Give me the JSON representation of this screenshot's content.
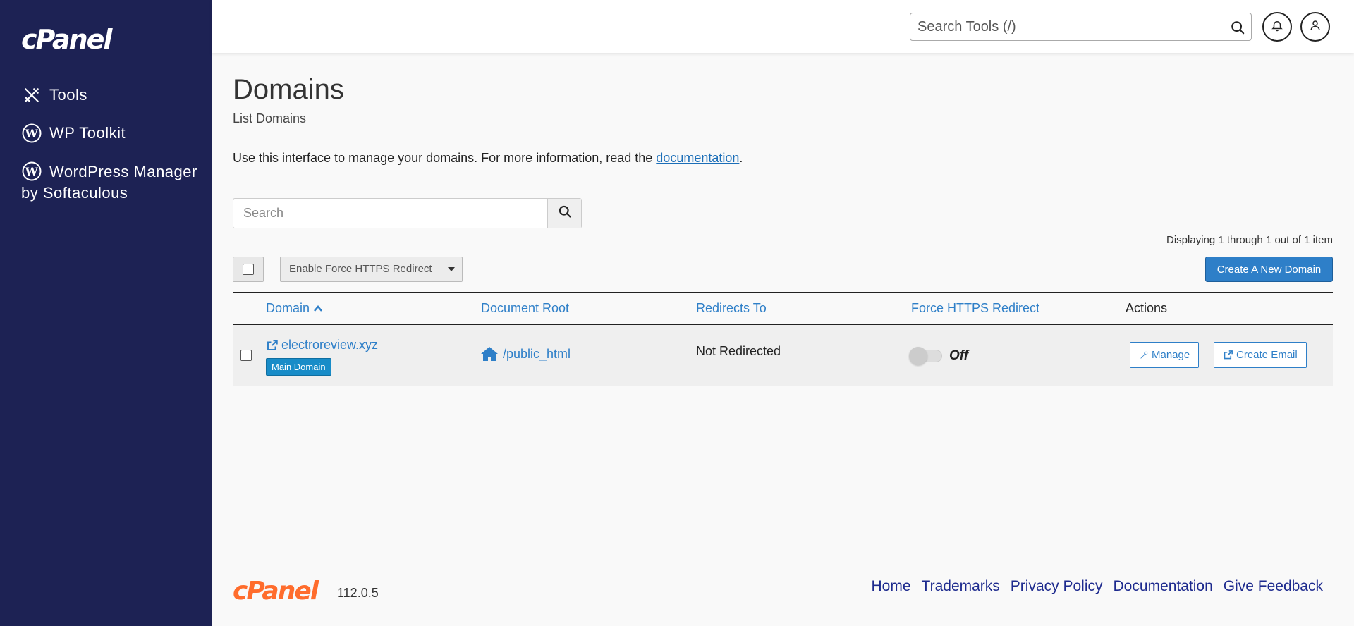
{
  "brand": {
    "logo": "cPanel",
    "version": "112.0.5"
  },
  "sidebar": {
    "items": [
      {
        "label": "Tools",
        "icon": "tools-icon"
      },
      {
        "label": "WP Toolkit",
        "icon": "wordpress-icon"
      },
      {
        "label": "WordPress Manager by Softaculous",
        "icon": "wordpress-icon"
      }
    ]
  },
  "header": {
    "search_placeholder": "Search Tools (/)"
  },
  "page": {
    "title": "Domains",
    "subtitle": "List Domains",
    "intro_text": "Use this interface to manage your domains. For more information, read the ",
    "intro_link": "documentation",
    "intro_end": "."
  },
  "search": {
    "placeholder": "Search"
  },
  "toolbar": {
    "bulk_action": "Enable Force HTTPS Redirect",
    "create_label": "Create A New Domain",
    "displaying": "Displaying 1 through 1 out of 1 item"
  },
  "table": {
    "columns": {
      "domain": "Domain",
      "docroot": "Document Root",
      "redirects": "Redirects To",
      "https": "Force HTTPS Redirect",
      "actions": "Actions"
    },
    "rows": [
      {
        "domain": "electroreview.xyz",
        "badge": "Main Domain",
        "docroot": "/public_html",
        "redirects": "Not Redirected",
        "https_state": "Off",
        "manage_label": "Manage",
        "email_label": "Create Email"
      }
    ]
  },
  "footer": {
    "links": [
      "Home",
      "Trademarks",
      "Privacy Policy",
      "Documentation",
      "Give Feedback"
    ]
  },
  "colors": {
    "sidebar": "#1d2254",
    "link": "#2e7fc8",
    "accent": "#ff6c2c",
    "badge": "#188cc8"
  }
}
